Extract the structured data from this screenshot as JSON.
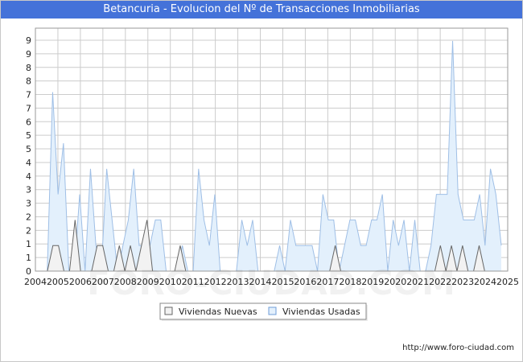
{
  "chart_data": {
    "type": "area",
    "title": "Betancuria - Evolucion del Nº de Transacciones Inmobiliarias",
    "ylim": [
      0,
      9.5
    ],
    "y_ticks": [
      0,
      1,
      1,
      2,
      2,
      3,
      3,
      4,
      4,
      5,
      5,
      6,
      7,
      7,
      8,
      8,
      9,
      9
    ],
    "x_ticks": [
      "2004",
      "2005",
      "2006",
      "2007",
      "2008",
      "2009",
      "2010",
      "2011",
      "2012",
      "2013",
      "2014",
      "2015",
      "2016",
      "2017",
      "2018",
      "2019",
      "2020",
      "2021",
      "2022",
      "2023",
      "2024",
      "2025"
    ],
    "grid": true,
    "legend_position": "bottom",
    "series": [
      {
        "name": "Viviendas Nuevas",
        "fill": "#f2f2f2",
        "stroke": "#666666",
        "values": [
          0,
          0,
          1,
          1,
          0,
          0,
          2,
          0,
          0,
          0,
          1,
          1,
          0,
          0,
          1,
          0,
          1,
          0,
          1,
          2,
          0,
          0,
          0,
          0,
          0,
          1,
          0,
          0,
          0,
          0,
          0,
          0,
          0,
          0,
          0,
          0,
          0,
          0,
          0,
          0,
          0,
          0,
          0,
          0,
          0,
          0,
          0,
          0,
          0,
          0,
          0,
          0,
          0,
          1,
          0,
          0,
          0,
          0,
          0,
          0,
          0,
          0,
          0,
          0,
          0,
          0,
          0,
          0,
          0,
          0,
          0,
          0,
          1,
          0,
          1,
          0,
          1,
          0,
          0,
          1,
          0,
          0,
          0,
          0
        ]
      },
      {
        "name": "Viviendas Usadas",
        "fill": "#e3f0fc",
        "stroke": "#9fbfe6",
        "values": [
          0,
          0,
          7,
          3,
          5,
          0,
          0,
          3,
          0,
          4,
          1,
          0,
          4,
          2,
          0,
          1,
          2,
          4,
          1,
          1,
          1,
          2,
          2,
          0,
          0,
          0,
          1,
          0,
          0,
          4,
          2,
          1,
          3,
          0,
          0,
          0,
          0,
          2,
          1,
          2,
          0,
          0,
          0,
          0,
          1,
          0,
          2,
          1,
          1,
          1,
          1,
          0,
          3,
          2,
          2,
          0,
          1,
          2,
          2,
          1,
          1,
          2,
          2,
          3,
          0,
          2,
          1,
          2,
          0,
          2,
          0,
          0,
          1,
          3,
          3,
          3,
          9,
          3,
          2,
          2,
          2,
          3,
          1,
          4,
          3,
          1
        ]
      }
    ]
  },
  "footer": {
    "url": "http://www.foro-ciudad.com"
  },
  "watermark": "FORO-CIUDAD.COM",
  "colors": {
    "title_bar": "#4472d9",
    "grid": "#cccccc"
  }
}
